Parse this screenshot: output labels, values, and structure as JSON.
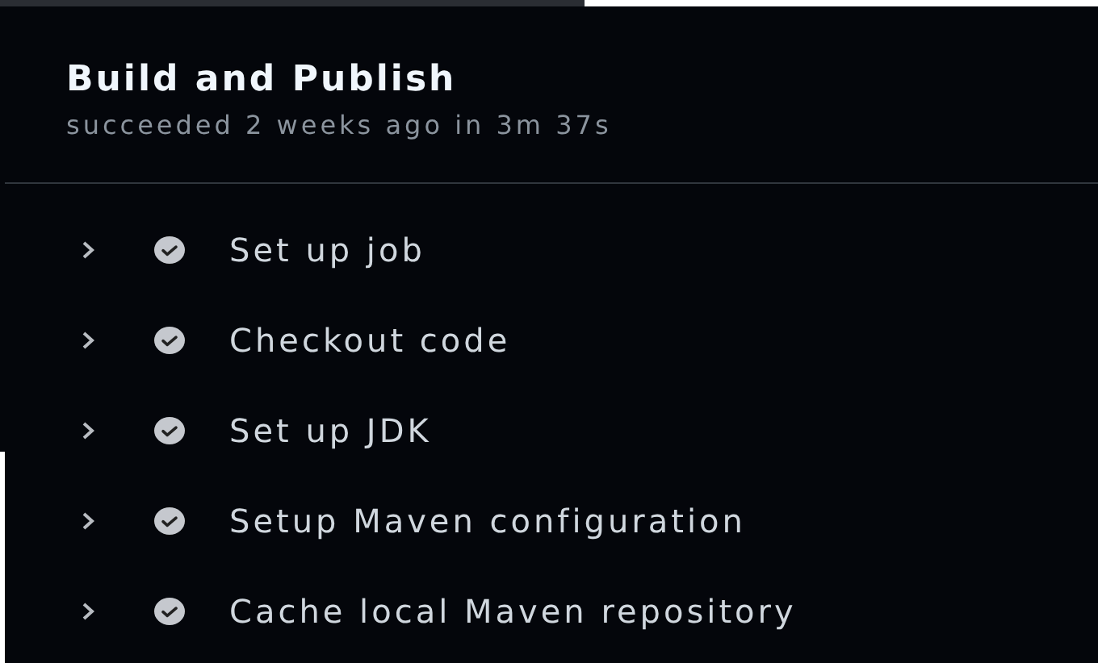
{
  "job": {
    "title": "Build and Publish",
    "summary": "succeeded 2 weeks ago in 3m 37s"
  },
  "steps": [
    {
      "name": "Set up job",
      "kind": "success",
      "expanded": false
    },
    {
      "name": "Checkout code",
      "kind": "success",
      "expanded": false
    },
    {
      "name": "Set up JDK",
      "kind": "success",
      "expanded": false
    },
    {
      "name": "Setup Maven configuration",
      "kind": "success",
      "expanded": false
    },
    {
      "name": "Cache local Maven repository",
      "kind": "success",
      "expanded": false
    }
  ]
}
